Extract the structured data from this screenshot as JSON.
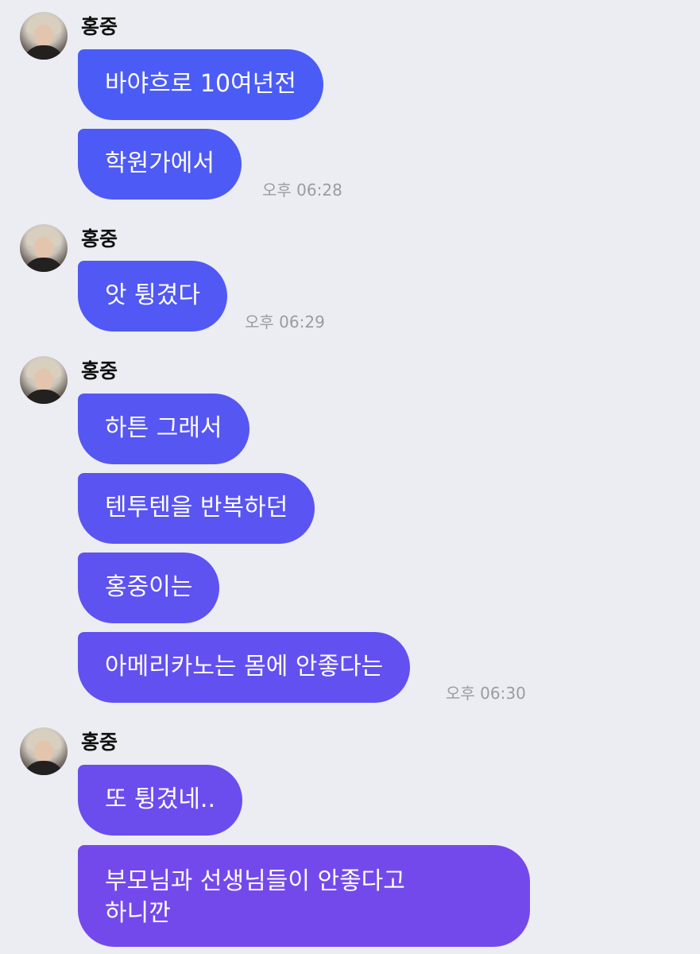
{
  "chat": {
    "groups": [
      {
        "sender": "홍중",
        "messages": [
          "바야흐로 10여년전",
          "학원가에서"
        ],
        "time": "오후 06:28"
      },
      {
        "sender": "홍중",
        "messages": [
          "앗 튕겼다"
        ],
        "time": "오후 06:29"
      },
      {
        "sender": "홍중",
        "messages": [
          "하튼 그래서",
          "텐투텐을 반복하던",
          "홍중이는",
          "아메리카노는 몸에 안좋다는"
        ],
        "time": "오후 06:30"
      },
      {
        "sender": "홍중",
        "messages": [
          "또 튕겼네..",
          "부모님과 선생님들이 안좋다고",
          "하니깐"
        ],
        "time": ""
      }
    ]
  },
  "colors": {
    "background": "#ebedf3",
    "bubble_gradient_start": "#4a5df6",
    "bubble_gradient_end": "#7b46ea",
    "time_text": "#9a9ca3",
    "sender_text": "#111111"
  },
  "icons": {
    "avatar": "profile-photo-avatar"
  }
}
